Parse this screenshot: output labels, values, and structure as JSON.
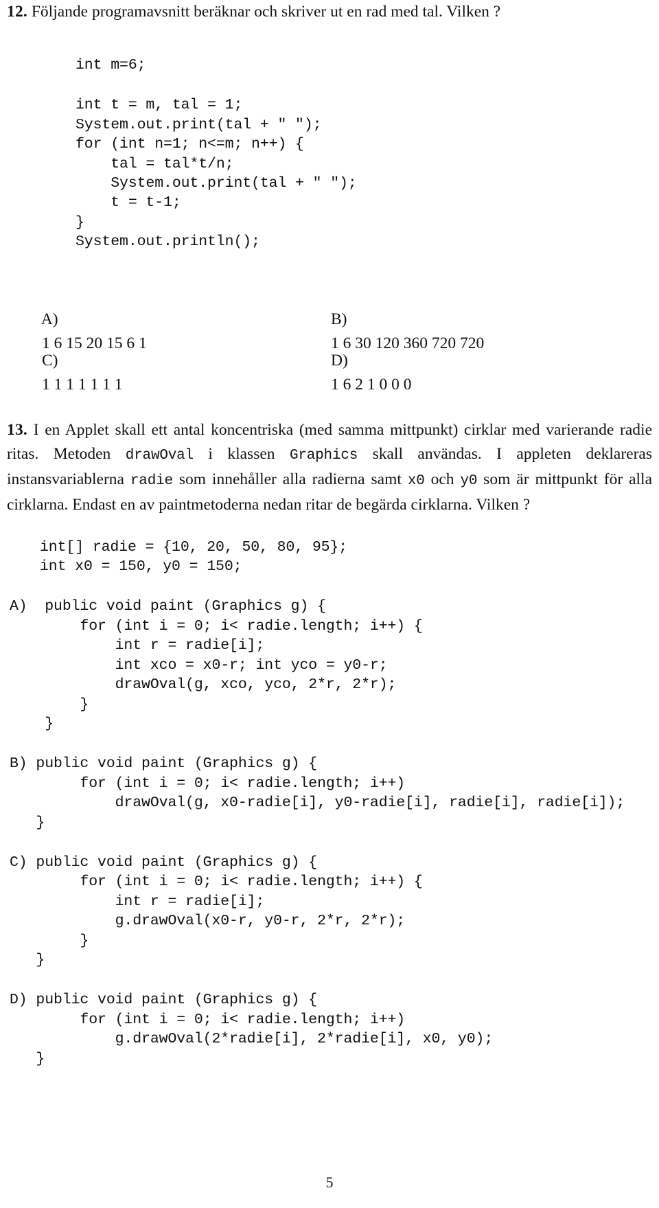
{
  "page": {
    "folio": "5"
  },
  "q12": {
    "number": "12.",
    "prompt": "Följande programavsnitt beräknar och skriver ut en rad med tal. Vilken ?",
    "code_head": "int m=6;",
    "code_body": "int t = m, tal = 1;\nSystem.out.print(tal + \" \");\nfor (int n=1; n<=m; n++) {\n    tal = tal*t/n;\n    System.out.print(tal + \" \");\n    t = t-1;\n}\nSystem.out.println();",
    "options": {
      "a_label": "A)",
      "a_text": "1 6 15 20 15 6 1",
      "b_label": "B)",
      "b_text": "1 6 30 120 360 720 720",
      "c_label": "C)",
      "c_text": "1 1 1 1 1 1 1",
      "d_label": "D)",
      "d_text": "1 6 2 1 0 0 0"
    }
  },
  "q13": {
    "number": "13.",
    "prompt_part1": "I en Applet skall ett antal koncentriska (med samma mittpunkt) cirklar med varierande radie ritas. Metoden ",
    "method_name": "drawOval",
    "prompt_part2": " i klassen ",
    "class_name": "Graphics",
    "prompt_part3": " skall användas. I appleten deklareras instansvariablerna ",
    "var_radie": "radie",
    "prompt_part4": " som innehåller alla radierna samt ",
    "var_x0": "x0",
    "prompt_part5": " och ",
    "var_y0": "y0",
    "prompt_part6": " som är mittpunkt för alla cirklarna. Endast en av paintmetoderna nedan ritar de begärda cirklarna. Vilken ?",
    "declarations": "int[] radie = {10, 20, 50, 80, 95};\nint x0 = 150, y0 = 150;",
    "answers": [
      {
        "label": "A)",
        "code": "A)  public void paint (Graphics g) {\n        for (int i = 0; i< radie.length; i++) {\n            int r = radie[i];\n            int xco = x0-r; int yco = y0-r;\n            drawOval(g, xco, yco, 2*r, 2*r);\n        }\n    }"
      },
      {
        "label": "B)",
        "code": "B) public void paint (Graphics g) {\n        for (int i = 0; i< radie.length; i++)\n            drawOval(g, x0-radie[i], y0-radie[i], radie[i], radie[i]);\n   }"
      },
      {
        "label": "C)",
        "code": "C) public void paint (Graphics g) {\n        for (int i = 0; i< radie.length; i++) {\n            int r = radie[i];\n            g.drawOval(x0-r, y0-r, 2*r, 2*r);\n        }\n   }"
      },
      {
        "label": "D)",
        "code": "D) public void paint (Graphics g) {\n        for (int i = 0; i< radie.length; i++)\n            g.drawOval(2*radie[i], 2*radie[i], x0, y0);\n   }"
      }
    ]
  }
}
